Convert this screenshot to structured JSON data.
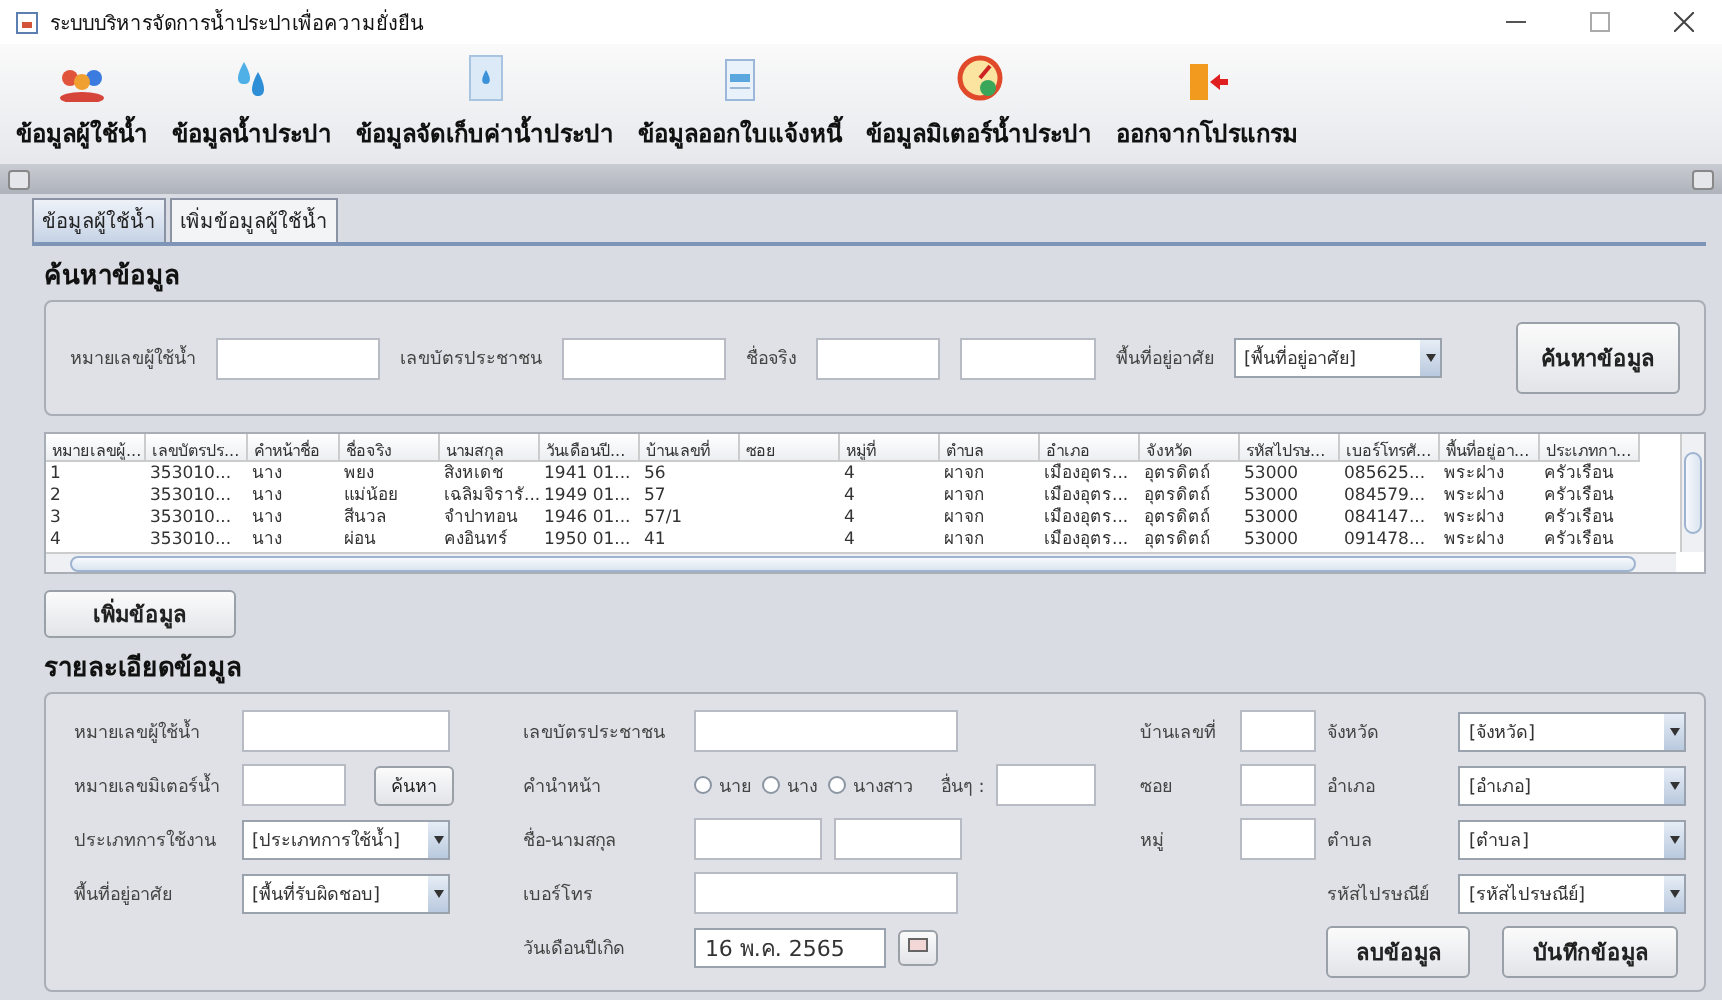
{
  "window": {
    "title": "ระบบบริหารจัดการน้ำประปาเพื่อความยั่งยืน"
  },
  "toolbar": [
    {
      "label": "ข้อมูลผู้ใช้น้ำ",
      "kind": "people"
    },
    {
      "label": "ข้อมูลน้ำประปา",
      "kind": "drops"
    },
    {
      "label": "ข้อมูลจัดเก็บค่าน้ำประปา",
      "kind": "doc"
    },
    {
      "label": "ข้อมูลออกใบแจ้งหนี้",
      "kind": "bill"
    },
    {
      "label": "ข้อมูลมิเตอร์น้ำประปา",
      "kind": "gauge"
    },
    {
      "label": "ออกจากโปรแกรม",
      "kind": "exit"
    }
  ],
  "tabs": [
    {
      "label": "ข้อมูลผู้ใช้น้ำ",
      "selected": true
    },
    {
      "label": "เพิ่มข้อมูลผู้ใช้น้ำ",
      "selected": false
    }
  ],
  "search": {
    "title": "ค้นหาข้อมูล",
    "fields": [
      {
        "label": "หมายเลขผู้ใช้น้ำ",
        "kind": "text"
      },
      {
        "label": "เลขบัตรประชาชน",
        "kind": "text"
      },
      {
        "label": "ชื่อจริง",
        "kind": "text2"
      },
      {
        "label": "พื้นที่อยู่อาศัย",
        "kind": "select",
        "value": "[พื้นที่อยู่อาศัย]"
      }
    ],
    "button": "ค้นหาข้อมูล"
  },
  "table": {
    "columns": [
      "หมายเลขผู้...",
      "เลขบัตรปร...",
      "คำหน้าชื่อ",
      "ชื่อจริง",
      "นามสกุล",
      "วันเดือนปี...",
      "บ้านเลขที่",
      "ซอย",
      "หมู่ที่",
      "ตำบล",
      "อำเภอ",
      "จังหวัด",
      "รหัสไปรษ...",
      "เบอร์โทรศั...",
      "พื้นที่อยู่อา...",
      "ประเภทกา..."
    ],
    "rows": [
      [
        "1",
        "353010...",
        "นาง",
        "พยง",
        "สิงหเดช",
        "1941 01...",
        "56",
        null,
        "4",
        "ผาจก",
        "เมืองอุตร...",
        "อุตรดิตถ์",
        "53000",
        "085625...",
        "พระฝาง",
        "ครัวเรือน"
      ],
      [
        "2",
        "353010...",
        "นาง",
        "แม่น้อย",
        "เฉลิมจิรารั...",
        "1949 01...",
        "57",
        null,
        "4",
        "ผาจก",
        "เมืองอุตร...",
        "อุตรดิตถ์",
        "53000",
        "084579...",
        "พระฝาง",
        "ครัวเรือน"
      ],
      [
        "3",
        "353010...",
        "นาง",
        "สีนวล",
        "จำปาทอน",
        "1946 01...",
        "57/1",
        null,
        "4",
        "ผาจก",
        "เมืองอุตร...",
        "อุตรดิตถ์",
        "53000",
        "084147...",
        "พระฝาง",
        "ครัวเรือน"
      ],
      [
        "4",
        "353010...",
        "นาง",
        "ผ่อน",
        "คงอินทร์",
        "1950 01...",
        "41",
        null,
        "4",
        "ผาจก",
        "เมืองอุตร...",
        "อุตรดิตถ์",
        "53000",
        "091478...",
        "พระฝาง",
        "ครัวเรือน"
      ]
    ]
  },
  "add_button": "เพิ่มข้อมูล",
  "details": {
    "title": "รายละเอียดข้อมูล",
    "col_1": [
      {
        "label": "หมายเลขผู้ใช้น้ำ",
        "kind": "text"
      },
      {
        "label": "หมายเลขมิเตอร์น้ำ",
        "kind": "search",
        "button": "ค้นหา"
      },
      {
        "label": "ประเภทการใช้งาน",
        "kind": "select",
        "value": "[ประเภทการใช้น้ำ]"
      },
      {
        "label": "พื้นที่อยู่อาศัย",
        "kind": "select",
        "value": "[พื้นที่รับผิดชอบ]"
      }
    ],
    "col_2": [
      {
        "label": "เลขบัตรประชาชน",
        "kind": "text"
      },
      {
        "label": "คำนำหน้า",
        "kind": "radio",
        "options": [
          {
            "label": "นาย",
            "selected": false
          },
          {
            "label": "นาง",
            "selected": false
          },
          {
            "label": "นางสาว",
            "selected": false
          }
        ],
        "other": "อื่นๆ :"
      },
      {
        "label": "ชื่อ-นามสกุล",
        "kind": "text2"
      },
      {
        "label": "เบอร์โทร",
        "kind": "text"
      },
      {
        "label": "วันเดือนปีเกิด",
        "kind": "date",
        "value": "16 พ.ค. 2565"
      }
    ],
    "col_3": [
      {
        "label": "บ้านเลขที่",
        "kind": "text"
      },
      {
        "label": "ซอย",
        "kind": "text"
      },
      {
        "label": "หมู่",
        "kind": "text"
      }
    ],
    "col_4": [
      {
        "label": "จังหวัด",
        "kind": "select",
        "value": "[จังหวัด]"
      },
      {
        "label": "อำเภอ",
        "kind": "select",
        "value": "[อำเภอ]"
      },
      {
        "label": "ตำบล",
        "kind": "select",
        "value": "[ตำบล]"
      },
      {
        "label": "รหัสไปรษณีย์",
        "kind": "select",
        "value": "[รหัสไปรษณีย์]"
      }
    ],
    "buttons": [
      "ลบข้อมูล",
      "บันทึกข้อมูล"
    ]
  }
}
